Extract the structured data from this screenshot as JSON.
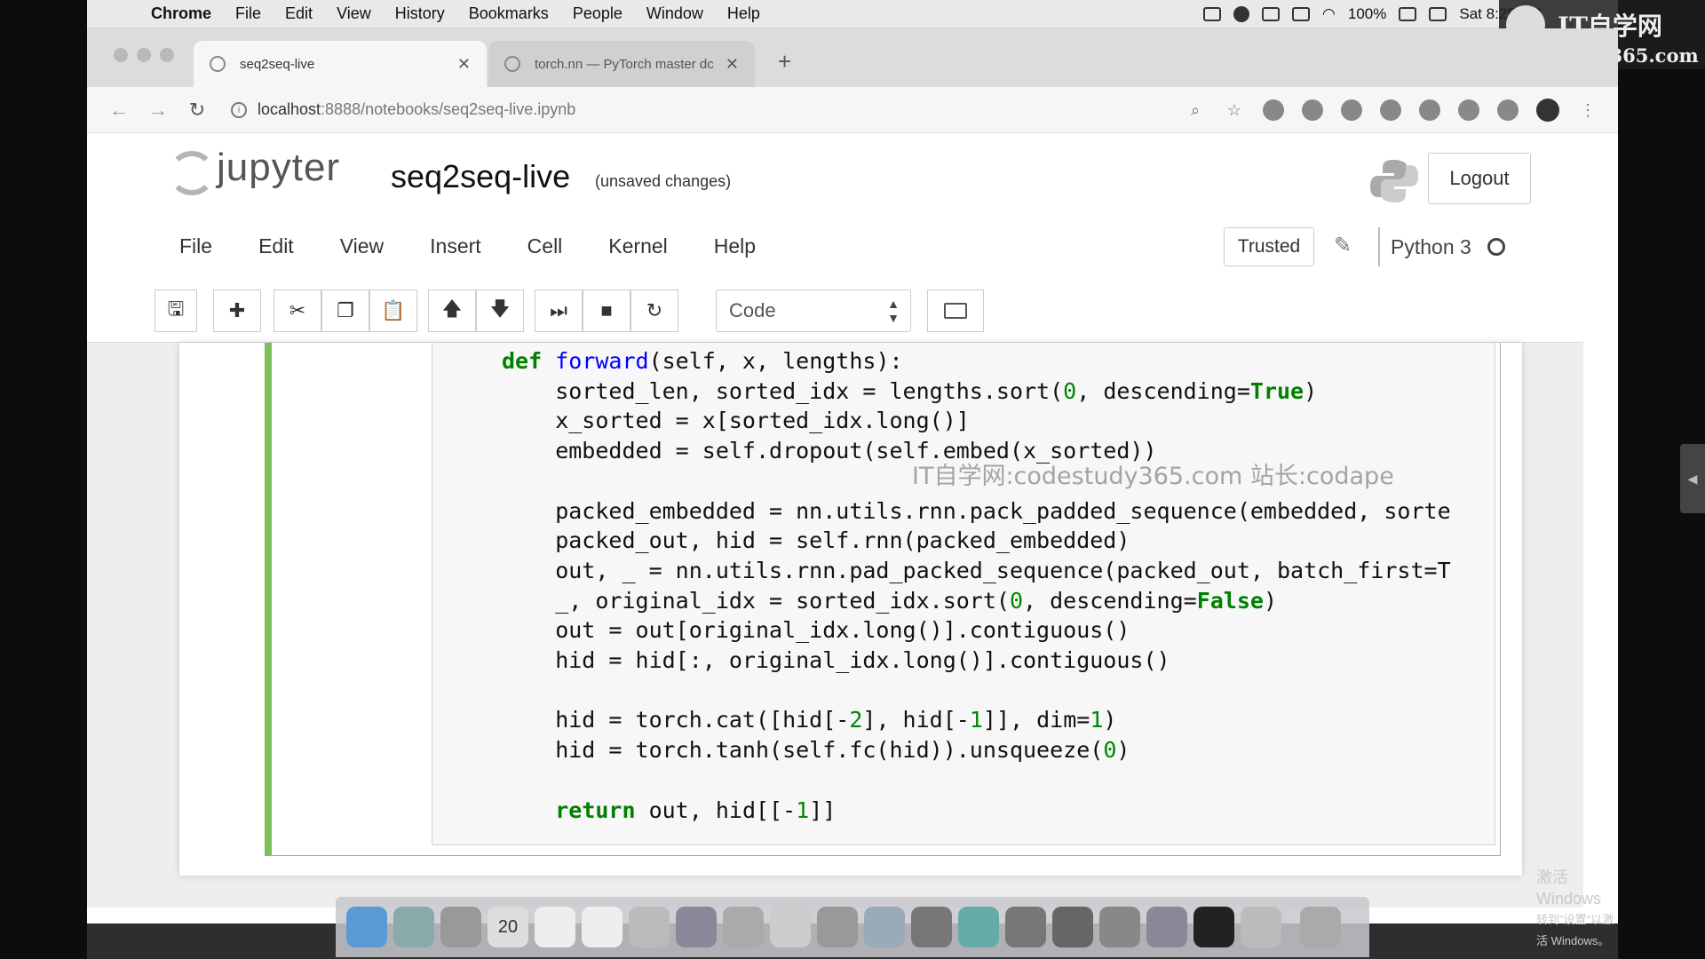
{
  "menubar": {
    "app": "Chrome",
    "items": [
      "File",
      "Edit",
      "View",
      "History",
      "Bookmarks",
      "People",
      "Window",
      "Help"
    ],
    "battery": "100%",
    "clock": "Sat 8:25 AM"
  },
  "watermark": {
    "title": "IT自学网",
    "site": "codestudy365.com",
    "overlay": "IT自学网:codestudy365.com 站长:codape"
  },
  "browser": {
    "tabs": [
      {
        "title": "seq2seq-live"
      },
      {
        "title": "torch.nn — PyTorch master dc"
      }
    ],
    "new_tab": "+",
    "url_host": "localhost",
    "url_rest": ":8888/notebooks/seq2seq-live.ipynb"
  },
  "jupyter": {
    "brand": "jupyter",
    "notebook_title": "seq2seq-live",
    "status": "(unsaved changes)",
    "logout_label": "Logout",
    "menu": [
      "File",
      "Edit",
      "View",
      "Insert",
      "Cell",
      "Kernel",
      "Help"
    ],
    "trusted_label": "Trusted",
    "kernel_name": "Python 3",
    "cell_type": "Code"
  },
  "windows_activation": {
    "line1": "激活 Windows",
    "line2": "转到\"设置\"以激活 Windows。"
  },
  "colors": {
    "cell_border_edit": "#7dbd5a",
    "keyword": "#008000"
  }
}
